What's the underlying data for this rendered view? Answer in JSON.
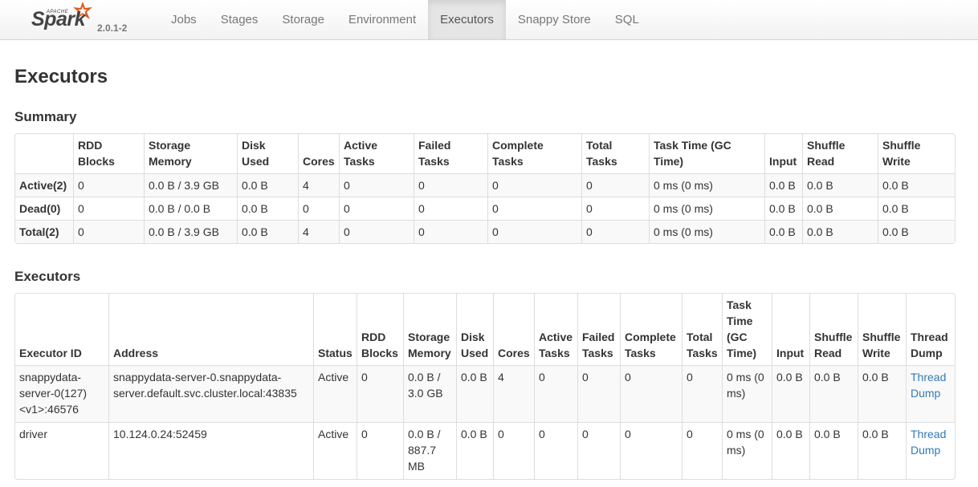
{
  "brand": {
    "apache": "APACHE",
    "spark": "Spark",
    "version": "2.0.1-2"
  },
  "nav": [
    {
      "label": "Jobs",
      "active": false
    },
    {
      "label": "Stages",
      "active": false
    },
    {
      "label": "Storage",
      "active": false
    },
    {
      "label": "Environment",
      "active": false
    },
    {
      "label": "Executors",
      "active": true
    },
    {
      "label": "Snappy Store",
      "active": false
    },
    {
      "label": "SQL",
      "active": false
    }
  ],
  "page_title": "Executors",
  "summary": {
    "title": "Summary",
    "headers": [
      "",
      "RDD Blocks",
      "Storage Memory",
      "Disk Used",
      "Cores",
      "Active Tasks",
      "Failed Tasks",
      "Complete Tasks",
      "Total Tasks",
      "Task Time (GC Time)",
      "Input",
      "Shuffle Read",
      "Shuffle Write"
    ],
    "rows": [
      [
        "Active(2)",
        "0",
        "0.0 B / 3.9 GB",
        "0.0 B",
        "4",
        "0",
        "0",
        "0",
        "0",
        "0 ms (0 ms)",
        "0.0 B",
        "0.0 B",
        "0.0 B"
      ],
      [
        "Dead(0)",
        "0",
        "0.0 B / 0.0 B",
        "0.0 B",
        "0",
        "0",
        "0",
        "0",
        "0",
        "0 ms (0 ms)",
        "0.0 B",
        "0.0 B",
        "0.0 B"
      ],
      [
        "Total(2)",
        "0",
        "0.0 B / 3.9 GB",
        "0.0 B",
        "4",
        "0",
        "0",
        "0",
        "0",
        "0 ms (0 ms)",
        "0.0 B",
        "0.0 B",
        "0.0 B"
      ]
    ]
  },
  "executors": {
    "title": "Executors",
    "headers": [
      "Executor ID",
      "Address",
      "Status",
      "RDD Blocks",
      "Storage Memory",
      "Disk Used",
      "Cores",
      "Active Tasks",
      "Failed Tasks",
      "Complete Tasks",
      "Total Tasks",
      "Task Time (GC Time)",
      "Input",
      "Shuffle Read",
      "Shuffle Write",
      "Thread Dump"
    ],
    "rows": [
      [
        "snappydata-server-0(127)<v1>:46576",
        "snappydata-server-0.snappydata-server.default.svc.cluster.local:43835",
        "Active",
        "0",
        "0.0 B / 3.0 GB",
        "0.0 B",
        "4",
        "0",
        "0",
        "0",
        "0",
        "0 ms (0 ms)",
        "0.0 B",
        "0.0 B",
        "0.0 B",
        "Thread Dump"
      ],
      [
        "driver",
        "10.124.0.24:52459",
        "Active",
        "0",
        "0.0 B / 887.7 MB",
        "0.0 B",
        "0",
        "0",
        "0",
        "0",
        "0",
        "0 ms (0 ms)",
        "0.0 B",
        "0.0 B",
        "0.0 B",
        "Thread Dump"
      ]
    ]
  }
}
